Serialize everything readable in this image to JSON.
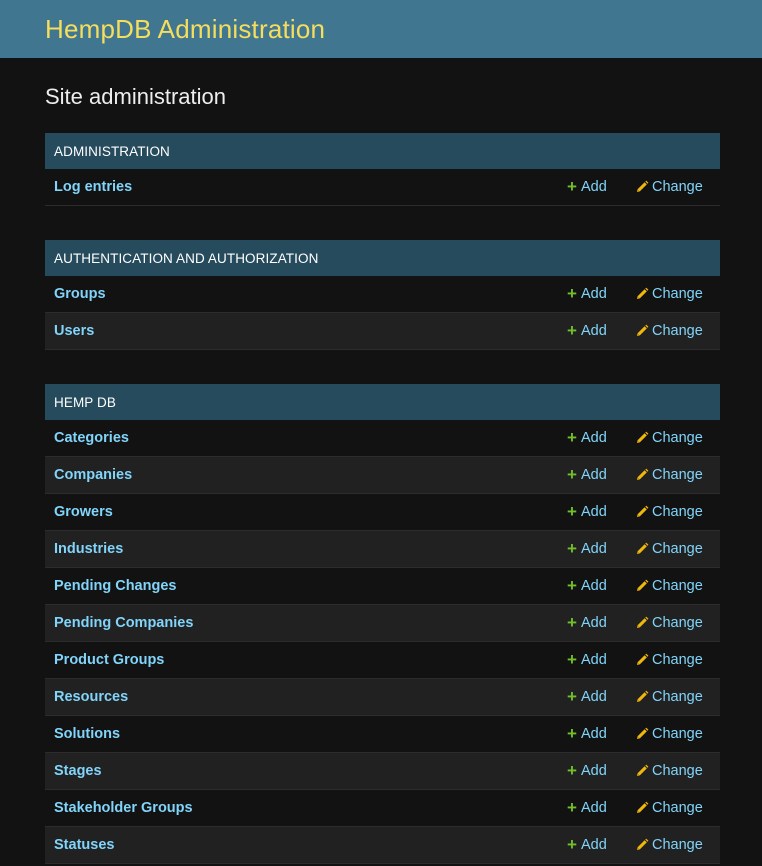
{
  "header": {
    "brand": "HempDB Administration"
  },
  "page": {
    "title": "Site administration"
  },
  "colors": {
    "header_bg": "#417690",
    "brand": "#f5dd5d",
    "caption_bg": "#264b5d",
    "link": "#81d4fa",
    "add_icon": "#70bf2b",
    "change_icon": "#efb80b"
  },
  "actions": {
    "add_label": "Add",
    "change_label": "Change",
    "add_icon": "plus-icon",
    "change_icon": "pencil-icon"
  },
  "modules": [
    {
      "caption": "Administration",
      "models": [
        "Log entries"
      ]
    },
    {
      "caption": "Authentication and Authorization",
      "models": [
        "Groups",
        "Users"
      ]
    },
    {
      "caption": "Hemp DB",
      "models": [
        "Categories",
        "Companies",
        "Growers",
        "Industries",
        "Pending Changes",
        "Pending Companies",
        "Product Groups",
        "Resources",
        "Solutions",
        "Stages",
        "Stakeholder Groups",
        "Statuses"
      ]
    }
  ]
}
